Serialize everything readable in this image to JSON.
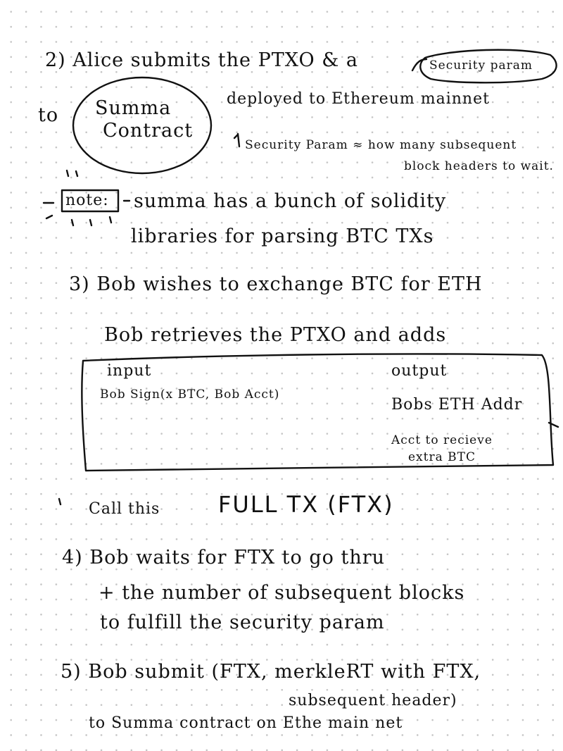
{
  "step2": {
    "line1": "2) Alice submits the PTXO & a",
    "security_bubble": "Security param",
    "to_word": "to",
    "summa_line1": "Summa",
    "summa_line2": "Contract",
    "deployed": "deployed to Ethereum mainnet",
    "sec_param_def1": "Security Param ≈ how many subsequent",
    "sec_param_def2": "block headers to wait."
  },
  "note": {
    "label": "note:",
    "line1": "summa has a bunch of solidity",
    "line2": "libraries for parsing BTC TXs"
  },
  "step3": {
    "line1": "3) Bob wishes to exchange BTC for ETH",
    "line2": "Bob retrieves the PTXO and adds",
    "box": {
      "input_header": "input",
      "input_value": "Bob Sign(x BTC, Bob Acct)",
      "output_header": "output",
      "output_value1": "Bobs ETH Addr",
      "output_value2a": "Acct to recieve",
      "output_value2b": "extra BTC"
    },
    "call_this": "Call this",
    "full_tx": "FULL TX (FTX)"
  },
  "step4": {
    "line1": "4) Bob waits for FTX to go thru",
    "line2": "+ the number of subsequent blocks",
    "line3": "to fulfill the security param"
  },
  "step5": {
    "line1": "5) Bob submit (FTX, merkleRT with FTX,",
    "line2": "subsequent header)",
    "line3": "to Summa contract on Ethe main net"
  }
}
